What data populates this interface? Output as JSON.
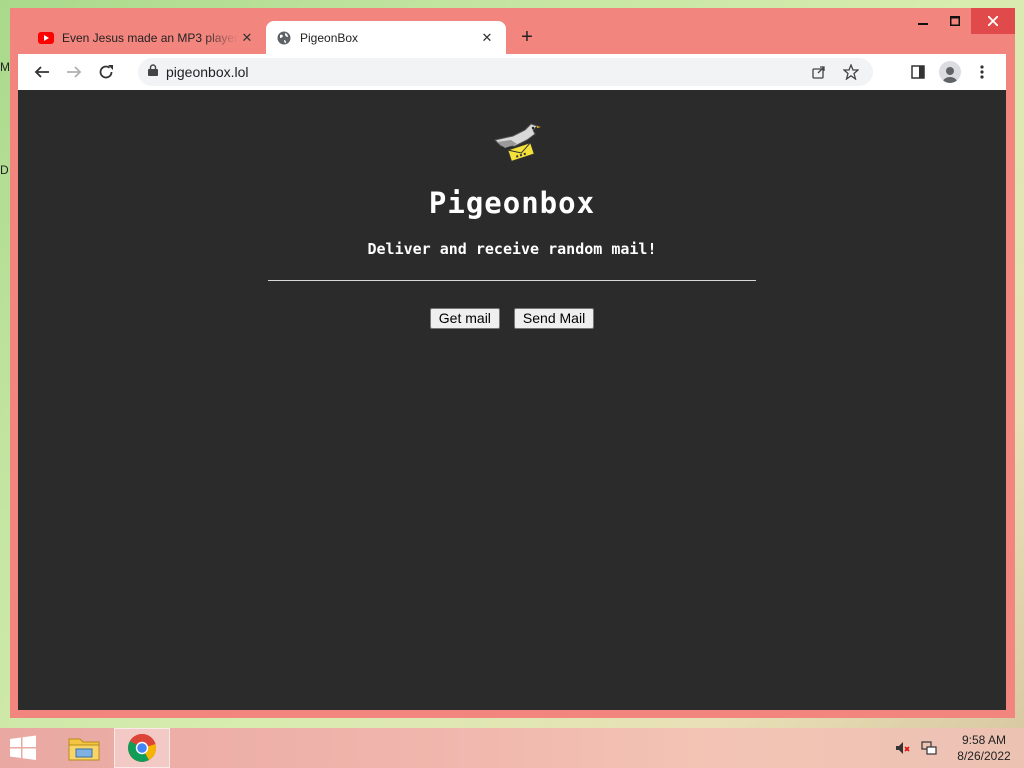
{
  "desktop": {
    "left_label_1": "M",
    "left_label_2": "D"
  },
  "browser": {
    "tabs": [
      {
        "title": "Even Jesus made an MP3 player...",
        "favicon": "youtube-icon",
        "active": false
      },
      {
        "title": "PigeonBox",
        "favicon": "globe-icon",
        "active": true
      }
    ],
    "new_tab_label": "+",
    "address": "pigeonbox.lol"
  },
  "page": {
    "logo": "pigeon-logo",
    "title": "Pigeonbox",
    "tagline": "Deliver and receive random mail!",
    "get_mail_label": "Get mail",
    "send_mail_label": "Send Mail"
  },
  "taskbar": {
    "time": "9:58 AM",
    "date": "8/26/2022"
  },
  "colors": {
    "window_frame": "#f3857f",
    "page_background": "#2b2b2b",
    "close_button": "#e14a4a"
  }
}
